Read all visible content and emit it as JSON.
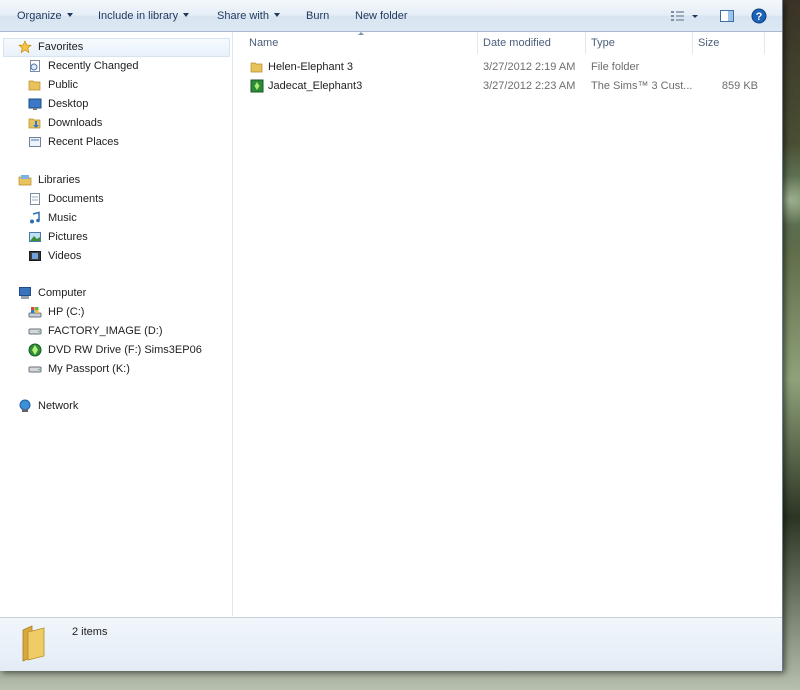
{
  "toolbar": {
    "organize": "Organize",
    "include_in_library": "Include in library",
    "share_with": "Share with",
    "burn": "Burn",
    "new_folder": "New folder"
  },
  "nav": {
    "favorites": {
      "title": "Favorites",
      "items": [
        "Recently Changed",
        "Public",
        "Desktop",
        "Downloads",
        "Recent Places"
      ]
    },
    "libraries": {
      "title": "Libraries",
      "items": [
        "Documents",
        "Music",
        "Pictures",
        "Videos"
      ]
    },
    "computer": {
      "title": "Computer",
      "items": [
        "HP (C:)",
        "FACTORY_IMAGE (D:)",
        "DVD RW Drive (F:) Sims3EP06",
        "My Passport (K:)"
      ]
    },
    "network": {
      "title": "Network"
    }
  },
  "columns": {
    "name": "Name",
    "date_modified": "Date modified",
    "type": "Type",
    "size": "Size"
  },
  "files": [
    {
      "name": "Helen-Elephant 3",
      "date": "3/27/2012 2:19 AM",
      "type": "File folder",
      "size": ""
    },
    {
      "name": "Jadecat_Elephant3",
      "date": "3/27/2012 2:23 AM",
      "type": "The Sims™ 3 Cust...",
      "size": "859 KB"
    }
  ],
  "details": {
    "count": "2 items"
  },
  "colors": {
    "accent": "#1e395b",
    "folder": "#e8c25c",
    "selection": "#e8f0fa"
  }
}
